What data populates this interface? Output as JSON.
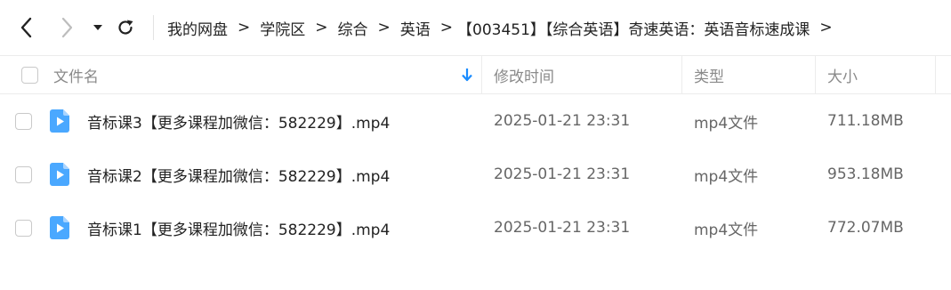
{
  "nav": {
    "back_icon": "chevron-left-icon",
    "forward_icon": "chevron-right-icon",
    "history_icon": "caret-down-icon",
    "refresh_icon": "refresh-icon"
  },
  "breadcrumb": [
    "我的网盘",
    "学院区",
    "综合",
    "英语",
    "【003451】【综合英语】奇速英语：英语音标速成课"
  ],
  "breadcrumb_separator": ">",
  "columns": {
    "name": "文件名",
    "modified": "修改时间",
    "type": "类型",
    "size": "大小",
    "sort_icon": "arrow-down-icon"
  },
  "files": [
    {
      "name": "音标课3【更多课程加微信：582229】.mp4",
      "modified": "2025-01-21 23:31",
      "type": "mp4文件",
      "size": "711.18MB",
      "icon": "video-file-icon"
    },
    {
      "name": "音标课2【更多课程加微信：582229】.mp4",
      "modified": "2025-01-21 23:31",
      "type": "mp4文件",
      "size": "953.18MB",
      "icon": "video-file-icon"
    },
    {
      "name": "音标课1【更多课程加微信：582229】.mp4",
      "modified": "2025-01-21 23:31",
      "type": "mp4文件",
      "size": "772.07MB",
      "icon": "video-file-icon"
    }
  ],
  "colors": {
    "accent": "#1a8cff",
    "file_icon": "#4aa8ff",
    "border": "#ececec"
  }
}
